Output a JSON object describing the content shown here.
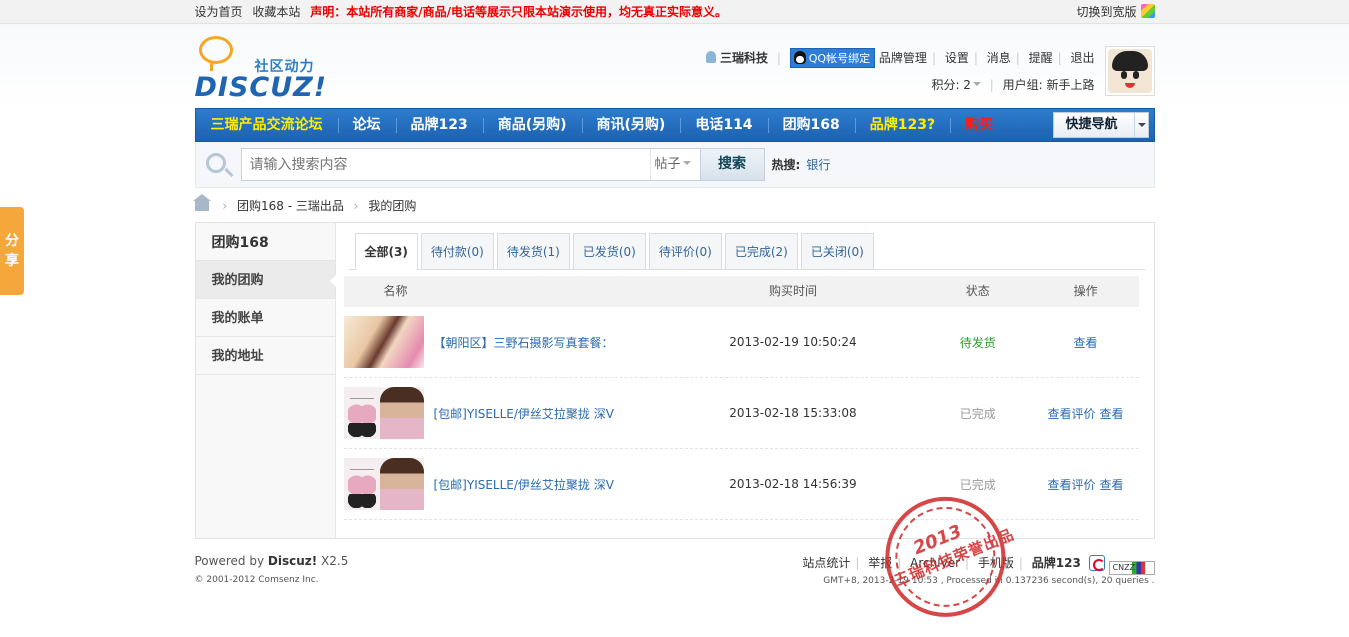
{
  "topbar": {
    "set_home": "设为首页",
    "bookmark": "收藏本站",
    "notice": "声明：本站所有商家/商品/电话等展示只限本站演示使用，均无真正实际意义。",
    "switch_wide": "切换到宽版"
  },
  "logo": {
    "tagline": "社区动力",
    "brand": "DISCUZ!"
  },
  "user": {
    "name": "三瑞科技",
    "qq_bind": "QQ帐号绑定",
    "links": [
      "品牌管理",
      "设置",
      "消息",
      "提醒",
      "退出"
    ],
    "points_label": "积分: 2",
    "group_label": "用户组: 新手上路"
  },
  "nav": {
    "items": [
      "三瑞产品交流论坛",
      "论坛",
      "品牌123",
      "商品(另购)",
      "商讯(另购)",
      "电话114",
      "团购168",
      "品牌123?",
      "购买"
    ],
    "quick_nav": "快捷导航"
  },
  "search": {
    "placeholder": "请输入搜索内容",
    "type": "帖子",
    "button": "搜索",
    "hot_label": "热搜:",
    "hot_word": "银行"
  },
  "breadcrumb": {
    "items": [
      "团购168 - 三瑞出品",
      "我的团购"
    ]
  },
  "sidebar": {
    "title": "团购168",
    "items": [
      "我的团购",
      "我的账单",
      "我的地址"
    ]
  },
  "tabs": [
    "全部(3)",
    "待付款(0)",
    "待发货(1)",
    "已发货(0)",
    "待评价(0)",
    "已完成(2)",
    "已关闭(0)"
  ],
  "table": {
    "headers": [
      "名称",
      "购买时间",
      "状态",
      "操作"
    ],
    "rows": [
      {
        "title": "【朝阳区】三野石摄影写真套餐：",
        "time": "2013-02-19 10:50:24",
        "status": "待发货",
        "ops": [
          "查看"
        ]
      },
      {
        "title": "[包邮]YISELLE/伊丝艾拉聚拢 深V",
        "time": "2013-02-18 15:33:08",
        "status": "已完成",
        "ops": [
          "查看评价",
          "查看"
        ]
      },
      {
        "title": "[包邮]YISELLE/伊丝艾拉聚拢 深V",
        "time": "2013-02-18 14:56:39",
        "status": "已完成",
        "ops": [
          "查看评价",
          "查看"
        ]
      }
    ]
  },
  "footer": {
    "powered_prefix": "Powered by ",
    "powered_brand": "Discuz!",
    "powered_version": " X2.5",
    "copyright": "© 2001-2012 Comsenz Inc.",
    "links": [
      "站点统计",
      "举报",
      "Archiver",
      "手机版"
    ],
    "brand_link": "品牌123",
    "cnzz": "CNZZ",
    "gmt": "GMT+8, 2013-2-19 10:53 , Processed in 0.137236 second(s), 20 queries ."
  },
  "stamp": {
    "year": "2013",
    "text": "三瑞科技荣誉出品"
  },
  "share": "分享"
}
